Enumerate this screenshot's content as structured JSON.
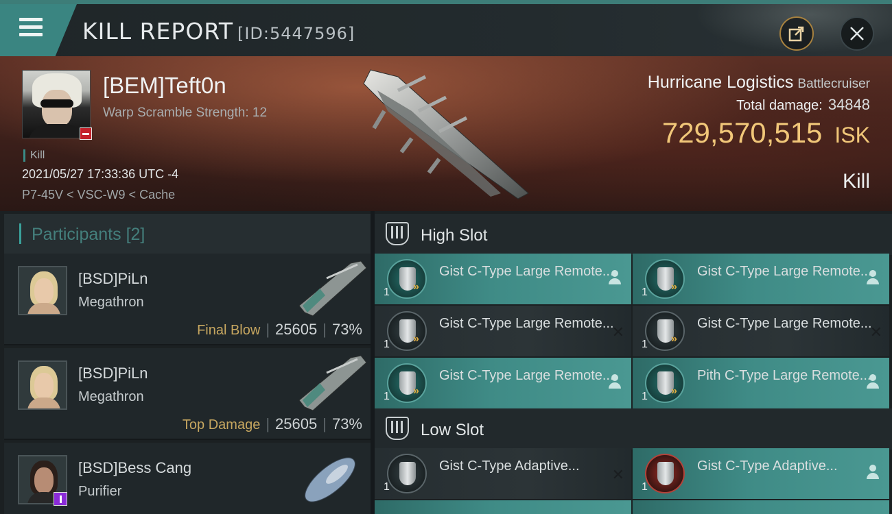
{
  "header": {
    "title": "KILL REPORT",
    "report_id": "[ID:5447596]"
  },
  "victim": {
    "name": "[BEM]Teft0n",
    "warp_scramble": "Warp Scramble Strength: 12",
    "kill_tag": "Kill",
    "timestamp": "2021/05/27 17:33:36 UTC -4",
    "location": "P7-45V < VSC-W9 < Cache",
    "ship_name": "Hurricane Logistics",
    "ship_class": "Battlecruiser",
    "total_damage_label": "Total damage:",
    "total_damage": "34848",
    "isk_value": "729,570,515",
    "isk_unit": "ISK",
    "result": "Kill"
  },
  "participants": {
    "title": "Participants",
    "count": "[2]",
    "rows": [
      {
        "name": "[BSD]PiLn",
        "ship": "Megathron",
        "role": "Final Blow",
        "damage": "25605",
        "percent": "73%"
      },
      {
        "name": "[BSD]PiLn",
        "ship": "Megathron",
        "role": "Top Damage",
        "damage": "25605",
        "percent": "73%"
      },
      {
        "name": "[BSD]Bess Cang",
        "ship": "Purifier"
      }
    ]
  },
  "fittings": {
    "high_slot_title": "High Slot",
    "low_slot_title": "Low Slot",
    "high_slot": [
      {
        "name": "Gist C-Type Large Remote...",
        "qty": "1",
        "state": "dropped"
      },
      {
        "name": "Gist C-Type Large Remote...",
        "qty": "1",
        "state": "dropped"
      },
      {
        "name": "Gist C-Type Large Remote...",
        "qty": "1",
        "state": "destroyed"
      },
      {
        "name": "Gist C-Type Large Remote...",
        "qty": "1",
        "state": "destroyed"
      },
      {
        "name": "Gist C-Type Large Remote...",
        "qty": "1",
        "state": "dropped"
      },
      {
        "name": "Pith C-Type Large Remote...",
        "qty": "1",
        "state": "dropped"
      }
    ],
    "low_slot": [
      {
        "name": "Gist C-Type Adaptive...",
        "qty": "1",
        "state": "destroyed"
      },
      {
        "name": "Gist C-Type Adaptive...",
        "qty": "1",
        "state": "dropped"
      }
    ]
  },
  "colors": {
    "accent_teal": "#3a8581",
    "isk_gold": "#f1c779",
    "dropped_module": "#3f8b86",
    "destroyed_module": "#2c3437"
  },
  "icons": [
    "menu-icon",
    "share-icon",
    "close-icon",
    "shield-module-icon",
    "user-icon",
    "destroyed-x-icon",
    "slot-rack-icon"
  ]
}
